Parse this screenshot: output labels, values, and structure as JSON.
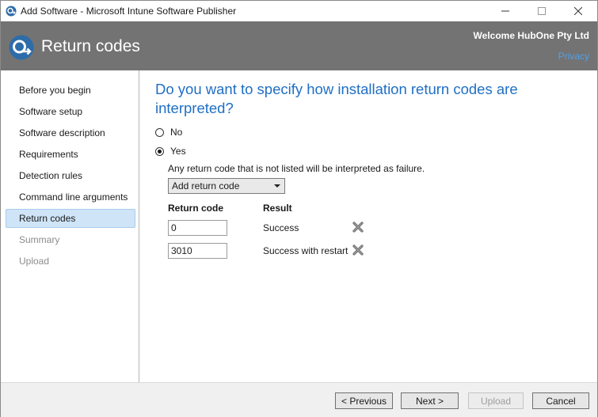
{
  "window": {
    "title": "Add Software - Microsoft Intune Software Publisher"
  },
  "header": {
    "page_title": "Return codes",
    "welcome": "Welcome HubOne Pty Ltd",
    "privacy_link": "Privacy"
  },
  "sidebar": {
    "items": [
      {
        "label": "Before you begin",
        "state": "normal"
      },
      {
        "label": "Software setup",
        "state": "normal"
      },
      {
        "label": "Software description",
        "state": "normal"
      },
      {
        "label": "Requirements",
        "state": "normal"
      },
      {
        "label": "Detection rules",
        "state": "normal"
      },
      {
        "label": "Command line arguments",
        "state": "normal"
      },
      {
        "label": "Return codes",
        "state": "selected"
      },
      {
        "label": "Summary",
        "state": "disabled"
      },
      {
        "label": "Upload",
        "state": "disabled"
      }
    ]
  },
  "main": {
    "question": "Do you want to specify how installation return codes are interpreted?",
    "options": {
      "no_label": "No",
      "yes_label": "Yes",
      "selected": "Yes"
    },
    "info": "Any return code that is not listed will be interpreted as failure.",
    "dropdown_label": "Add return code",
    "table": {
      "headers": [
        "Return code",
        "Result"
      ],
      "rows": [
        {
          "code": "0",
          "result": "Success"
        },
        {
          "code": "3010",
          "result": "Success with restart"
        }
      ]
    }
  },
  "footer": {
    "previous": "< Previous",
    "next": "Next >",
    "upload": "Upload",
    "cancel": "Cancel"
  },
  "colors": {
    "accent": "#1f6fc5",
    "header_bg": "#737373",
    "selection_bg": "#cfe4f7"
  }
}
